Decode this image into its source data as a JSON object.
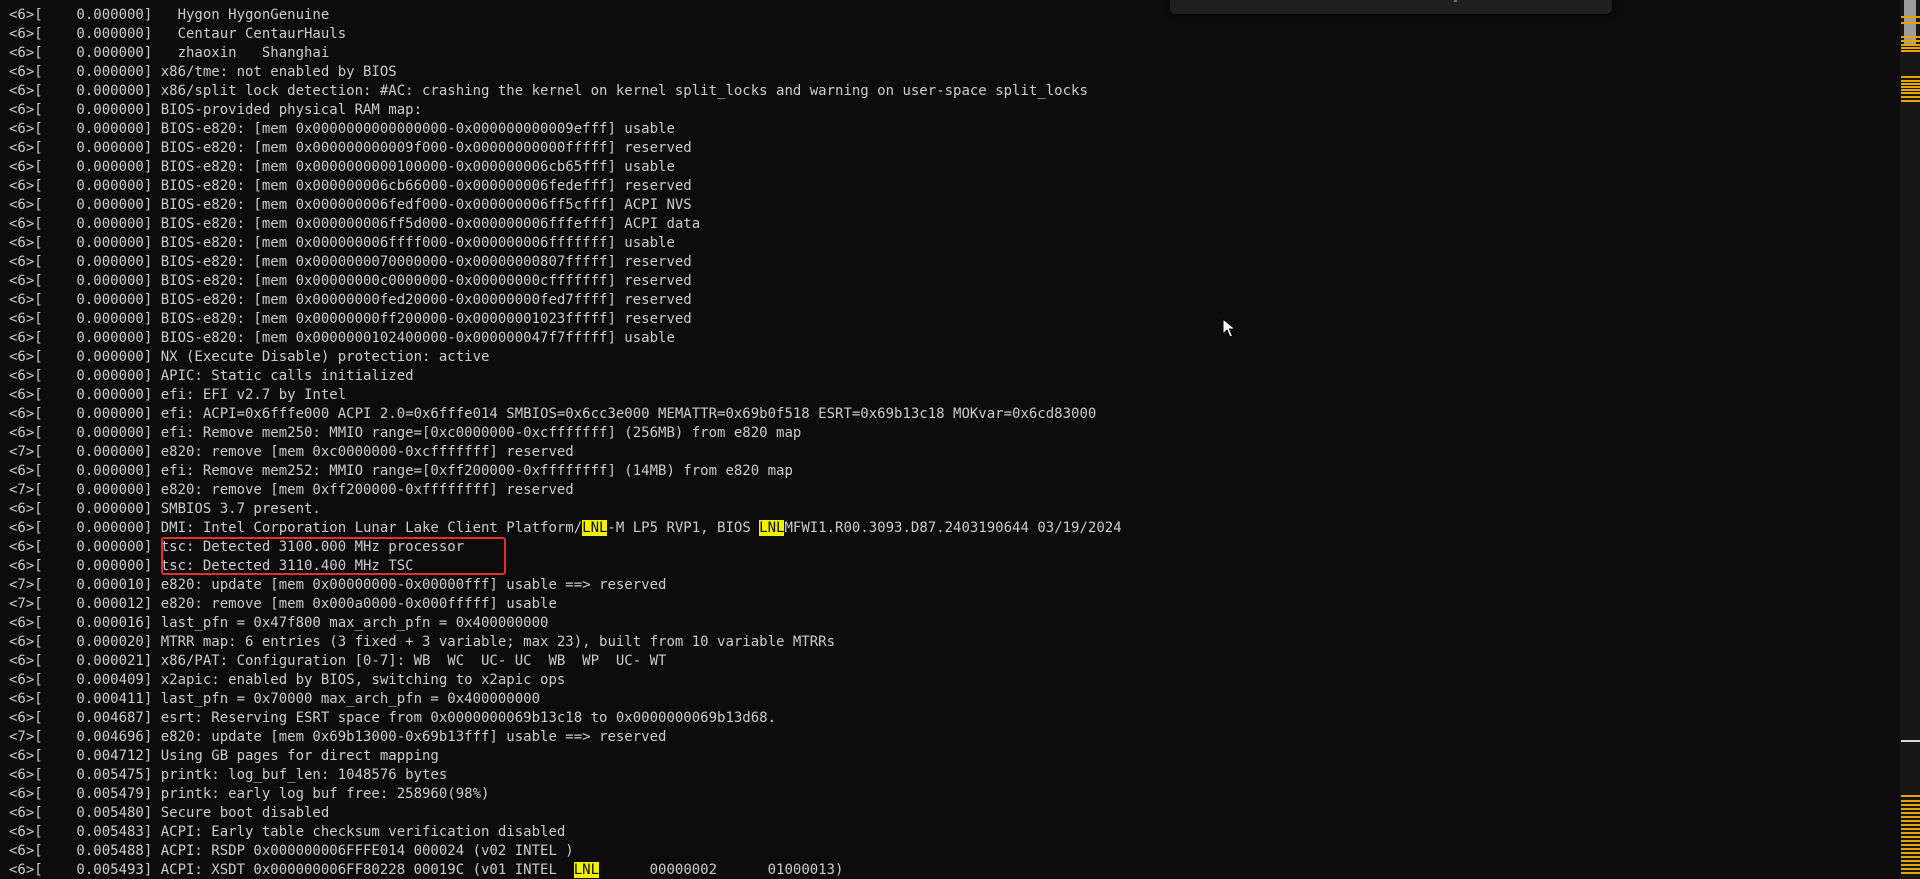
{
  "terminal": {
    "lines": [
      {
        "text": "<6>[    0.000000]   Hygon HygonGenuine"
      },
      {
        "text": "<6>[    0.000000]   Centaur CentaurHauls"
      },
      {
        "text": "<6>[    0.000000]   zhaoxin   Shanghai"
      },
      {
        "text": "<6>[    0.000000] x86/tme: not enabled by BIOS"
      },
      {
        "text": "<6>[    0.000000] x86/split lock detection: #AC: crashing the kernel on kernel split_locks and warning on user-space split_locks"
      },
      {
        "text": "<6>[    0.000000] BIOS-provided physical RAM map:"
      },
      {
        "text": "<6>[    0.000000] BIOS-e820: [mem 0x0000000000000000-0x000000000009efff] usable"
      },
      {
        "text": "<6>[    0.000000] BIOS-e820: [mem 0x000000000009f000-0x00000000000fffff] reserved"
      },
      {
        "text": "<6>[    0.000000] BIOS-e820: [mem 0x0000000000100000-0x000000006cb65fff] usable"
      },
      {
        "text": "<6>[    0.000000] BIOS-e820: [mem 0x000000006cb66000-0x000000006fedefff] reserved"
      },
      {
        "text": "<6>[    0.000000] BIOS-e820: [mem 0x000000006fedf000-0x000000006ff5cfff] ACPI NVS"
      },
      {
        "text": "<6>[    0.000000] BIOS-e820: [mem 0x000000006ff5d000-0x000000006fffefff] ACPI data"
      },
      {
        "text": "<6>[    0.000000] BIOS-e820: [mem 0x000000006ffff000-0x000000006fffffff] usable"
      },
      {
        "text": "<6>[    0.000000] BIOS-e820: [mem 0x0000000070000000-0x00000000807fffff] reserved"
      },
      {
        "text": "<6>[    0.000000] BIOS-e820: [mem 0x00000000c0000000-0x00000000cfffffff] reserved"
      },
      {
        "text": "<6>[    0.000000] BIOS-e820: [mem 0x00000000fed20000-0x00000000fed7ffff] reserved"
      },
      {
        "text": "<6>[    0.000000] BIOS-e820: [mem 0x00000000ff200000-0x00000001023fffff] reserved"
      },
      {
        "text": "<6>[    0.000000] BIOS-e820: [mem 0x0000000102400000-0x000000047f7fffff] usable"
      },
      {
        "text": "<6>[    0.000000] NX (Execute Disable) protection: active"
      },
      {
        "text": "<6>[    0.000000] APIC: Static calls initialized"
      },
      {
        "text": "<6>[    0.000000] efi: EFI v2.7 by Intel"
      },
      {
        "text": "<6>[    0.000000] efi: ACPI=0x6fffe000 ACPI 2.0=0x6fffe014 SMBIOS=0x6cc3e000 MEMATTR=0x69b0f518 ESRT=0x69b13c18 MOKvar=0x6cd83000"
      },
      {
        "text": "<6>[    0.000000] efi: Remove mem250: MMIO range=[0xc0000000-0xcfffffff] (256MB) from e820 map"
      },
      {
        "text": "<7>[    0.000000] e820: remove [mem 0xc0000000-0xcfffffff] reserved"
      },
      {
        "text": "<6>[    0.000000] efi: Remove mem252: MMIO range=[0xff200000-0xffffffff] (14MB) from e820 map"
      },
      {
        "text": "<7>[    0.000000] e820: remove [mem 0xff200000-0xffffffff] reserved"
      },
      {
        "text": "<6>[    0.000000] SMBIOS 3.7 present."
      },
      {
        "segments": [
          {
            "text": "<6>[    0.000000] DMI: Intel Corporation Lunar Lake Client Platform/"
          },
          {
            "text": "LNL",
            "highlight": true
          },
          {
            "text": "-M LP5 RVP1, BIOS "
          },
          {
            "text": "LNL",
            "highlight": true
          },
          {
            "text": "MFWI1.R00.3093.D87.2403190644 03/19/2024"
          }
        ]
      },
      {
        "text": "<6>[    0.000000] tsc: Detected 3100.000 MHz processor"
      },
      {
        "text": "<6>[    0.000000] tsc: Detected 3110.400 MHz TSC"
      },
      {
        "text": "<7>[    0.000010] e820: update [mem 0x00000000-0x00000fff] usable ==> reserved"
      },
      {
        "text": "<7>[    0.000012] e820: remove [mem 0x000a0000-0x000fffff] usable"
      },
      {
        "text": "<6>[    0.000016] last_pfn = 0x47f800 max_arch_pfn = 0x400000000"
      },
      {
        "text": "<6>[    0.000020] MTRR map: 6 entries (3 fixed + 3 variable; max 23), built from 10 variable MTRRs"
      },
      {
        "text": "<6>[    0.000021] x86/PAT: Configuration [0-7]: WB  WC  UC- UC  WB  WP  UC- WT"
      },
      {
        "text": "<6>[    0.000409] x2apic: enabled by BIOS, switching to x2apic ops"
      },
      {
        "text": "<6>[    0.000411] last_pfn = 0x70000 max_arch_pfn = 0x400000000"
      },
      {
        "text": "<6>[    0.004687] esrt: Reserving ESRT space from 0x0000000069b13c18 to 0x0000000069b13d68."
      },
      {
        "text": "<7>[    0.004696] e820: update [mem 0x69b13000-0x69b13fff] usable ==> reserved"
      },
      {
        "text": "<6>[    0.004712] Using GB pages for direct mapping"
      },
      {
        "text": "<6>[    0.005475] printk: log_buf_len: 1048576 bytes"
      },
      {
        "text": "<6>[    0.005479] printk: early log buf free: 258960(98%)"
      },
      {
        "text": "<6>[    0.005480] Secure boot disabled"
      },
      {
        "text": "<6>[    0.005483] ACPI: Early table checksum verification disabled"
      },
      {
        "text": "<6>[    0.005488] ACPI: RSDP 0x000000006FFFE014 000024 (v02 INTEL )"
      },
      {
        "segments": [
          {
            "text": "<6>[    0.005493] ACPI: XSDT 0x000000006FF80228 00019C (v01 INTEL  "
          },
          {
            "text": "LNL",
            "highlight": true
          },
          {
            "text": "      00000002      01000013)"
          }
        ]
      }
    ]
  },
  "colors": {
    "background": "#0c0c0c",
    "text": "#cccccc",
    "search_highlight": "#f2f200",
    "annotation_box": "#e03030",
    "scroll_marker": "#e8a300"
  },
  "icons": {
    "cursor": "mouse-pointer-icon"
  }
}
